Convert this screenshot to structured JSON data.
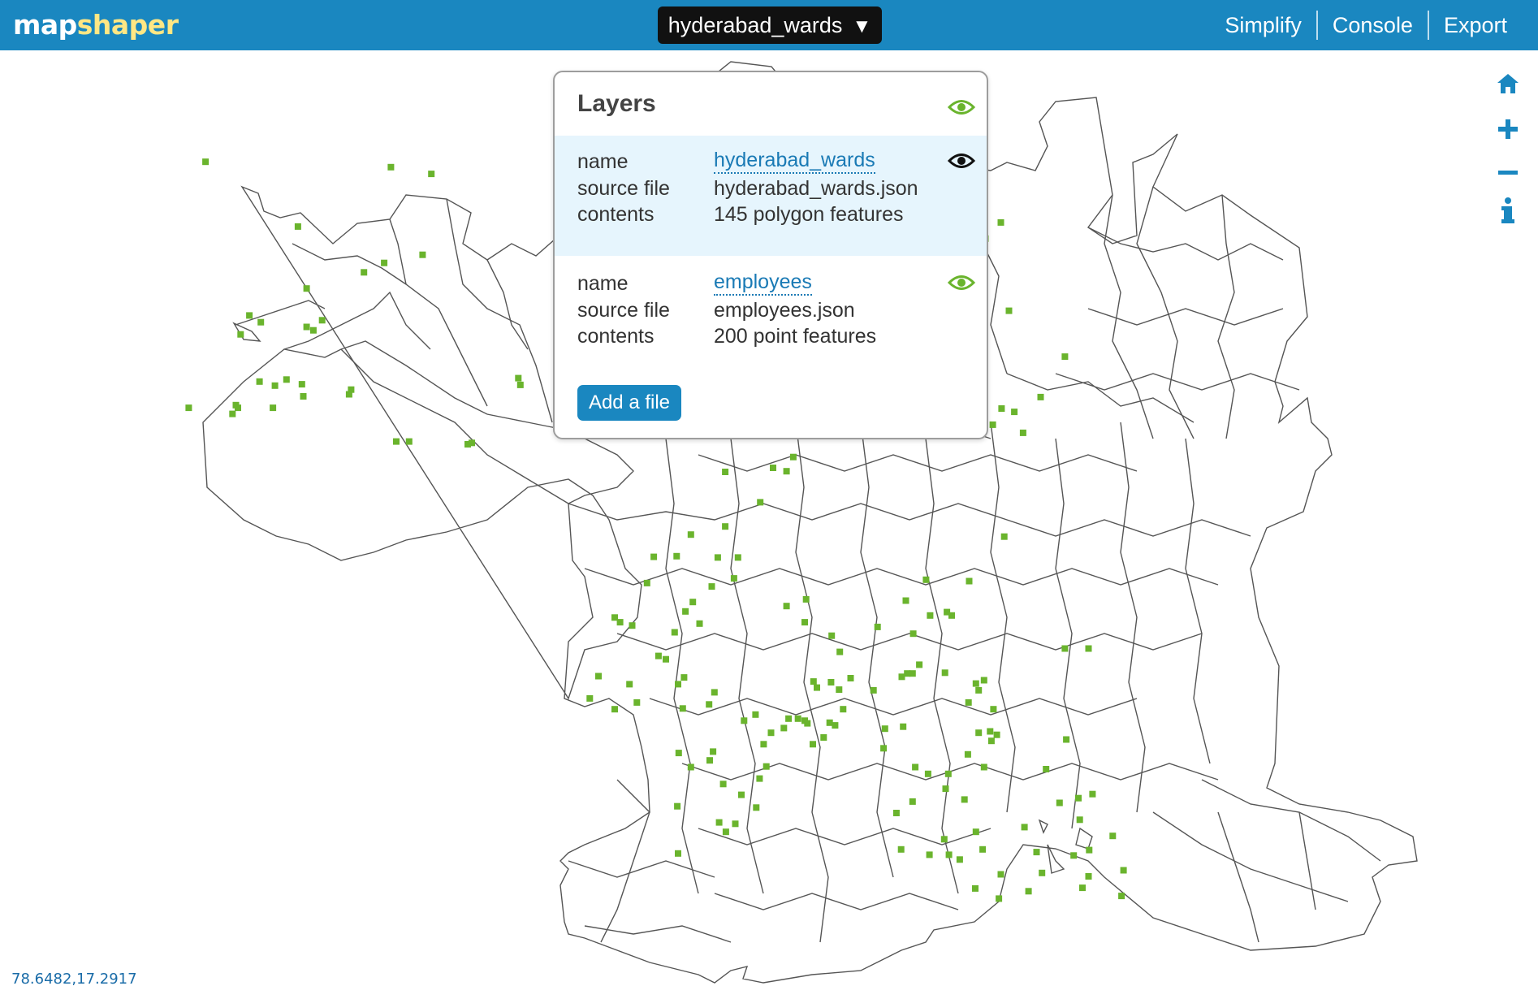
{
  "app": {
    "logo_part1": "map",
    "logo_part2": "shaper"
  },
  "header": {
    "layer_select_label": "hyderabad_wards",
    "menu": [
      "Simplify",
      "Console",
      "Export"
    ]
  },
  "tools": [
    "home-icon",
    "zoom-in-icon",
    "zoom-out-icon",
    "info-icon"
  ],
  "layers_panel": {
    "title": "Layers",
    "field_labels": {
      "name": "name",
      "source": "source file",
      "contents": "contents"
    },
    "layers": [
      {
        "name": "hyderabad_wards",
        "source_file": "hyderabad_wards.json",
        "contents": "145 polygon features",
        "active": true
      },
      {
        "name": "employees",
        "source_file": "employees.json",
        "contents": "200 point features",
        "active": false
      }
    ],
    "add_button": "Add a file"
  },
  "status": {
    "coordinates": "78.6482,17.2917"
  },
  "colors": {
    "accent": "#1a87c0",
    "point": "#6ab42d",
    "eye_on": "#6ab42d",
    "eye_active": "#111111"
  }
}
